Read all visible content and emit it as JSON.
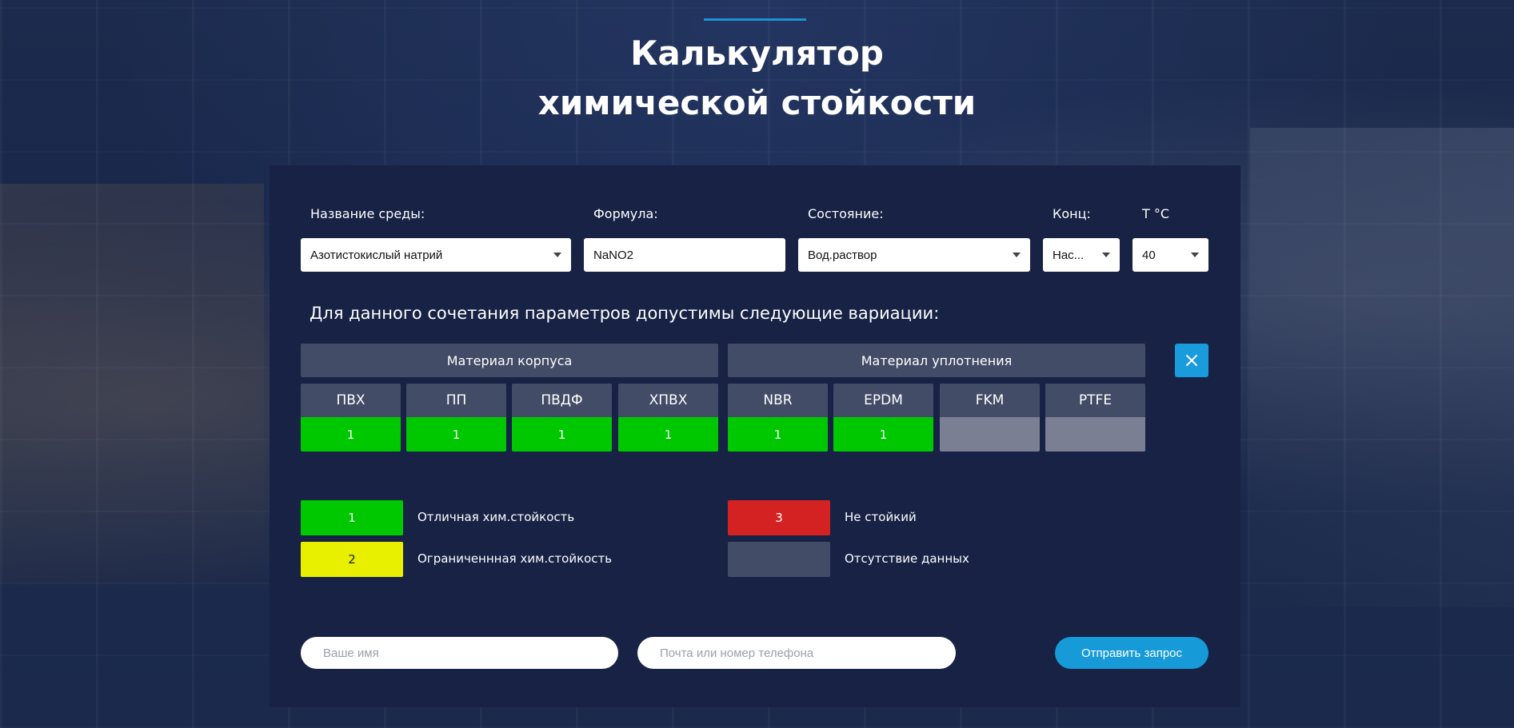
{
  "title": {
    "line1": "Калькулятор",
    "line2": "химической стойкости"
  },
  "form": {
    "medium_label": "Название среды:",
    "formula_label": "Формула:",
    "state_label": "Состояние:",
    "conc_label": "Конц:",
    "temp_label": "Т °С",
    "medium_value": "Азотистокислый натрий",
    "formula_value": "NaNO2",
    "state_value": "Вод.раствор",
    "conc_value": "Нас...",
    "temp_value": "40"
  },
  "results": {
    "info_text": "Для данного сочетания параметров допустимы следующие вариации:",
    "body_group": "Материал корпуса",
    "seal_group": "Материал уплотнения",
    "materials": [
      {
        "name": "ПВХ",
        "rating": "1",
        "color": "#00c800"
      },
      {
        "name": "ПП",
        "rating": "1",
        "color": "#00c800"
      },
      {
        "name": "ПВДФ",
        "rating": "1",
        "color": "#00c800"
      },
      {
        "name": "ХПВХ",
        "rating": "1",
        "color": "#00c800"
      },
      {
        "name": "NBR",
        "rating": "1",
        "color": "#00c800"
      },
      {
        "name": "EPDM",
        "rating": "1",
        "color": "#00c800"
      },
      {
        "name": "FKM",
        "rating": "",
        "color": "#7a7f93"
      },
      {
        "name": "PTFE",
        "rating": "",
        "color": "#7a7f93"
      }
    ]
  },
  "legend": [
    {
      "value": "1",
      "text": "Отличная хим.стойкость",
      "color": "#00c800",
      "text_color": "#ffffff"
    },
    {
      "value": "2",
      "text": "Ограниченнная хим.стойкость",
      "color": "#e8f000",
      "text_color": "#222222"
    },
    {
      "value": "3",
      "text": "Не стойкий",
      "color": "#d42222",
      "text_color": "#ffffff"
    },
    {
      "value": "",
      "text": "Отсутствие данных",
      "color": "#434c66",
      "text_color": "#ffffff"
    }
  ],
  "contact": {
    "name_placeholder": "Ваше имя",
    "contact_placeholder": "Почта или номер телефона",
    "submit_label": "Отправить запрос"
  },
  "icons": {
    "close": "close-icon",
    "dropdown": "chevron-down-icon"
  }
}
